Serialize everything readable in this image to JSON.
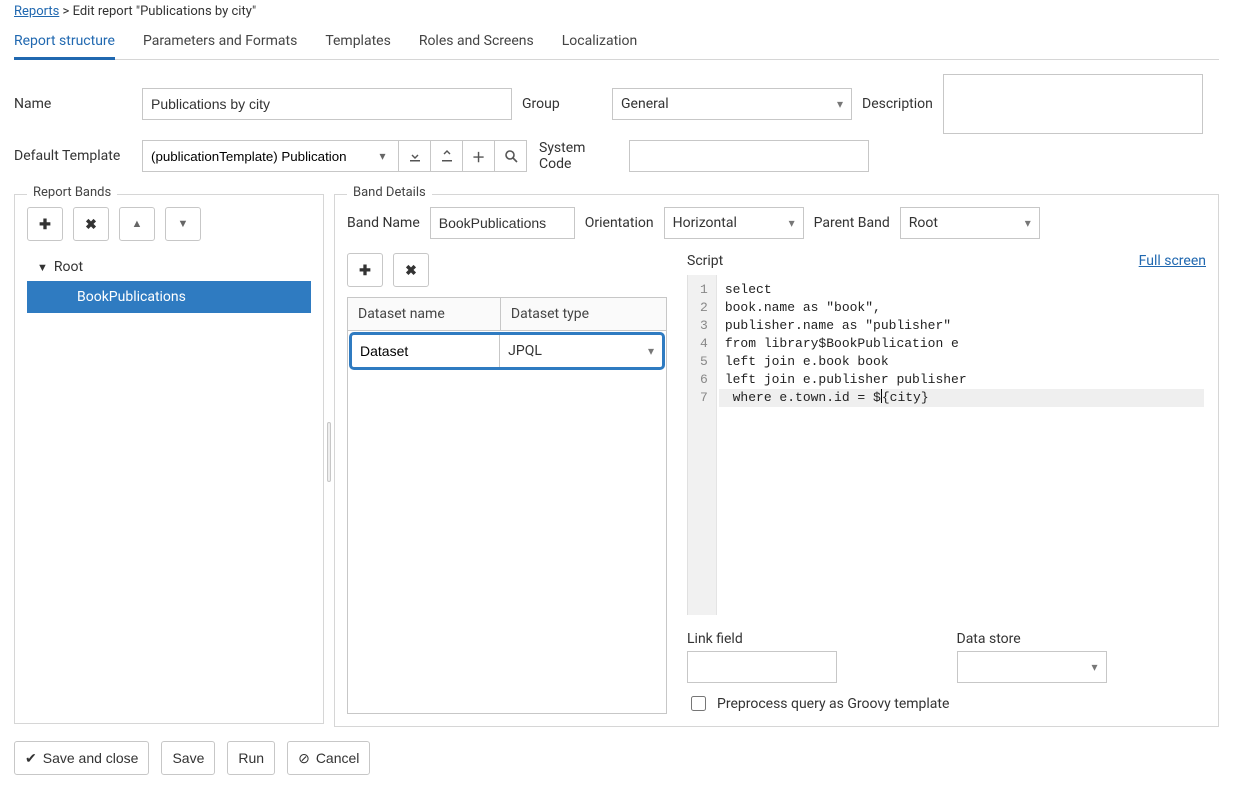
{
  "breadcrumb": {
    "root": "Reports",
    "current": "Edit report \"Publications by city\""
  },
  "tabs": [
    "Report structure",
    "Parameters and Formats",
    "Templates",
    "Roles and Screens",
    "Localization"
  ],
  "activeTab": 0,
  "form": {
    "nameLabel": "Name",
    "nameValue": "Publications by city",
    "groupLabel": "Group",
    "groupValue": "General",
    "descriptionLabel": "Description",
    "descriptionValue": "",
    "templateLabel": "Default Template",
    "templateValue": "(publicationTemplate) Publication",
    "systemCodeLabel": "System Code",
    "systemCodeValue": ""
  },
  "reportBands": {
    "legend": "Report Bands",
    "root": "Root",
    "items": [
      "BookPublications"
    ]
  },
  "bandDetails": {
    "legend": "Band Details",
    "bandNameLabel": "Band Name",
    "bandNameValue": "BookPublications",
    "orientationLabel": "Orientation",
    "orientationValue": "Horizontal",
    "parentBandLabel": "Parent Band",
    "parentBandValue": "Root",
    "datasetTable": {
      "col1": "Dataset name",
      "col2": "Dataset type",
      "row": {
        "name": "Dataset",
        "type": "JPQL"
      }
    },
    "script": {
      "label": "Script",
      "fullscreen": "Full screen",
      "lines": [
        "select",
        "book.name as \"book\",",
        "publisher.name as \"publisher\"",
        "from library$BookPublication e",
        "left join e.book book",
        "left join e.publisher publisher",
        " where e.town.id = ${city}"
      ]
    },
    "linkFieldLabel": "Link field",
    "linkFieldValue": "",
    "dataStoreLabel": "Data store",
    "dataStoreValue": "",
    "preprocessLabel": "Preprocess query as Groovy template",
    "preprocessChecked": false
  },
  "footer": {
    "saveClose": "Save and close",
    "save": "Save",
    "run": "Run",
    "cancel": "Cancel"
  }
}
